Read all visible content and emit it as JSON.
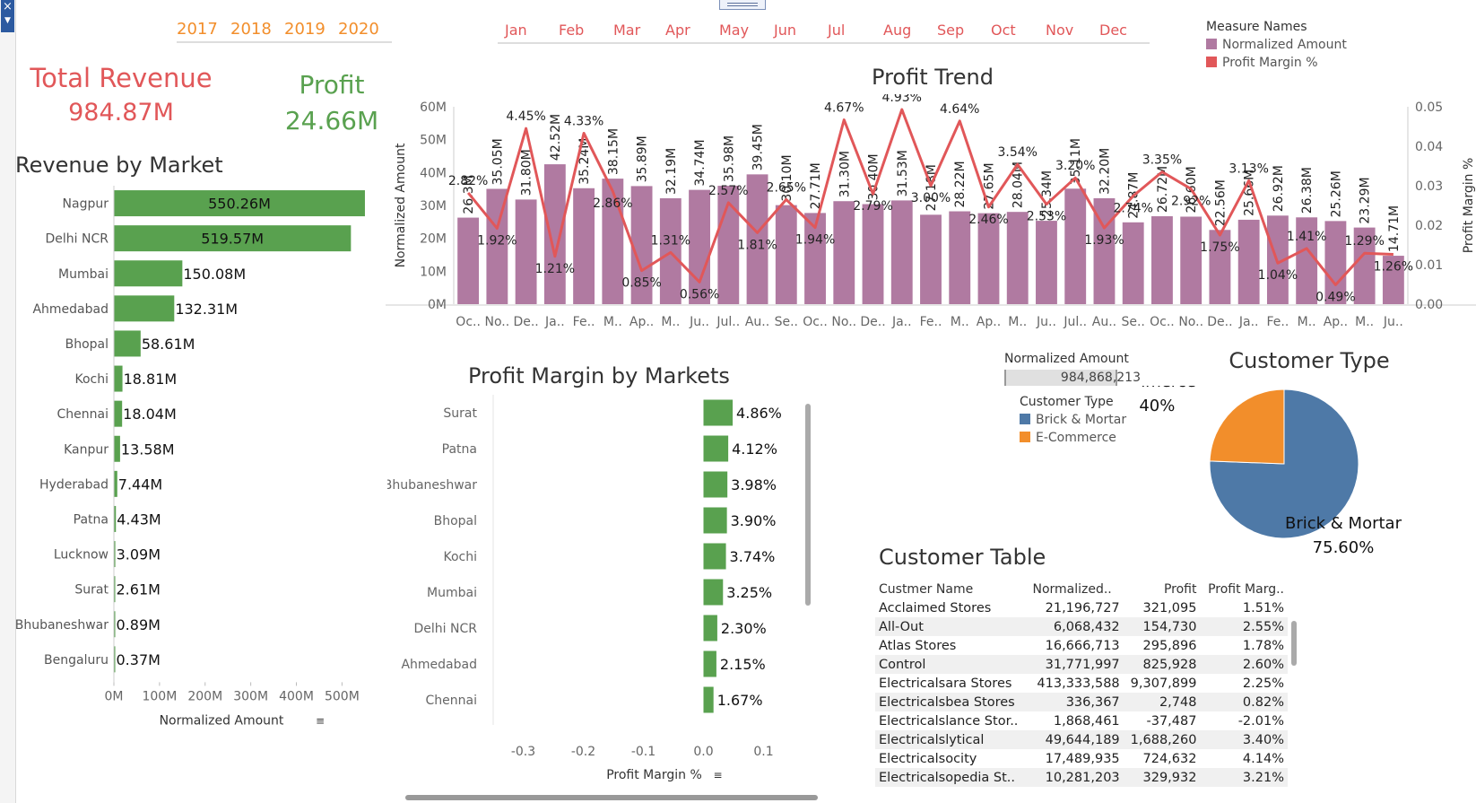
{
  "years": [
    "2017",
    "2018",
    "2019",
    "2020"
  ],
  "months": [
    "Jan",
    "Feb",
    "Mar",
    "Apr",
    "May",
    "Jun",
    "Jul",
    "Aug",
    "Sep",
    "Oct",
    "Nov",
    "Dec"
  ],
  "kpis": {
    "total_revenue_label": "Total Revenue",
    "total_revenue_value": "984.87M",
    "profit_label": "Profit",
    "profit_value": "24.66M"
  },
  "legend_measures": {
    "title": "Measure Names",
    "items": [
      {
        "label": "Normalized Amount",
        "color": "#b07aa1"
      },
      {
        "label": "Profit Margin %",
        "color": "#e15759"
      }
    ]
  },
  "customer_legend": {
    "title": "Customer Type",
    "items": [
      {
        "label": "Brick & Mortar",
        "color": "#4e79a7"
      },
      {
        "label": "E-Commerce",
        "color": "#f28e2b"
      }
    ]
  },
  "norm_filter": {
    "label": "Normalized Amount",
    "value": "984,868,213"
  },
  "colors": {
    "green": "#59a14f",
    "purple": "#b07aa1",
    "red": "#e15759",
    "blue": "#4e79a7",
    "orange": "#f28e2b"
  },
  "chart_data": [
    {
      "id": "revenue-by-market",
      "type": "bar",
      "orientation": "horizontal",
      "title": "Revenue by Market",
      "xlabel": "Normalized Amount",
      "xlim": [
        0,
        570
      ],
      "xticks": [
        "0M",
        "100M",
        "200M",
        "300M",
        "400M",
        "500M"
      ],
      "categories": [
        "Nagpur",
        "Delhi NCR",
        "Mumbai",
        "Ahmedabad",
        "Bhopal",
        "Kochi",
        "Chennai",
        "Kanpur",
        "Hyderabad",
        "Patna",
        "Lucknow",
        "Surat",
        "Bhubaneshwar",
        "Bengaluru"
      ],
      "values": [
        550.26,
        519.57,
        150.08,
        132.31,
        58.61,
        18.81,
        18.04,
        13.58,
        7.44,
        4.43,
        3.09,
        2.61,
        0.89,
        0.37
      ],
      "labels": [
        "550.26M",
        "519.57M",
        "150.08M",
        "132.31M",
        "58.61M",
        "18.81M",
        "18.04M",
        "13.58M",
        "7.44M",
        "4.43M",
        "3.09M",
        "2.61M",
        "0.89M",
        "0.37M"
      ]
    },
    {
      "id": "profit-trend",
      "type": "bar",
      "combo": "bar+line",
      "title": "Profit Trend",
      "ylabel": "Normalized Amount",
      "y2label": "Profit Margin %",
      "ylim": [
        0,
        60
      ],
      "y2lim": [
        0,
        0.05
      ],
      "yticks": [
        "0M",
        "10M",
        "20M",
        "30M",
        "40M",
        "50M",
        "60M"
      ],
      "y2ticks": [
        "0.00",
        "0.01",
        "0.02",
        "0.03",
        "0.04",
        "0.05"
      ],
      "categories": [
        "Oc..",
        "No..",
        "De..",
        "Ja..",
        "Fe..",
        "M..",
        "Ap..",
        "M..",
        "Ju..",
        "Jul..",
        "Au..",
        "Se..",
        "Oc..",
        "No..",
        "De..",
        "Ja..",
        "Fe..",
        "M..",
        "Ap..",
        "M..",
        "Ju..",
        "Jul..",
        "Au..",
        "Se..",
        "Oc..",
        "No..",
        "De..",
        "Ja..",
        "Fe..",
        "M..",
        "Ap..",
        "M..",
        "Ju.."
      ],
      "series": [
        {
          "name": "Normalized Amount",
          "values": [
            26.3,
            35.05,
            31.8,
            42.52,
            35.24,
            38.15,
            35.89,
            32.19,
            34.74,
            35.98,
            39.45,
            30.1,
            27.71,
            31.3,
            30.4,
            31.53,
            27.18,
            28.22,
            27.65,
            28.04,
            25.34,
            35.11,
            32.2,
            24.87,
            26.72,
            26.6,
            22.56,
            25.66,
            26.92,
            26.38,
            25.26,
            23.29,
            14.71
          ],
          "labels": [
            "26.3M",
            "35.05M",
            "31.80M",
            "42.52M",
            "35.24M",
            "38.15M",
            "35.89M",
            "32.19M",
            "34.74M",
            "35.98M",
            "39.45M",
            "30.10M",
            "27.71M",
            "31.30M",
            "30.40M",
            "31.53M",
            "27.18M",
            "28.22M",
            "27.65M",
            "28.04M",
            "25.34M",
            "35.11M",
            "32.20M",
            "24.87M",
            "26.72M",
            "26.60M",
            "22.56M",
            "25.66M",
            "26.92M",
            "26.38M",
            "25.26M",
            "23.29M",
            "14.71M"
          ]
        },
        {
          "name": "Profit Margin %",
          "values": [
            0.0282,
            0.0192,
            0.0445,
            0.0121,
            0.0433,
            0.0286,
            0.0085,
            0.0131,
            0.0056,
            0.0257,
            0.0181,
            0.0265,
            0.0194,
            0.0467,
            0.0279,
            0.0493,
            0.03,
            0.0464,
            0.0246,
            0.0354,
            0.0253,
            0.032,
            0.0193,
            0.0274,
            0.0335,
            0.0292,
            0.0175,
            0.0313,
            0.0104,
            0.0141,
            0.0049,
            0.0129,
            0.0126
          ],
          "labels": [
            "2.82%",
            "1.92%",
            "4.45%",
            "1.21%",
            "4.33%",
            "2.86%",
            "0.85%",
            "1.31%",
            "0.56%",
            "2.57%",
            "1.81%",
            "2.65%",
            "1.94%",
            "4.67%",
            "2.79%",
            "4.93%",
            "3.00%",
            "4.64%",
            "2.46%",
            "3.54%",
            "2.53%",
            "3.20%",
            "1.93%",
            "2.74%",
            "3.35%",
            "2.92%",
            "1.75%",
            "3.13%",
            "1.04%",
            "1.41%",
            "0.49%",
            "1.29%",
            "1.26%"
          ]
        }
      ]
    },
    {
      "id": "profit-margin-by-markets",
      "type": "bar",
      "orientation": "horizontal",
      "title": "Profit Margin by Markets",
      "xlabel": "Profit Margin %",
      "xlim": [
        -0.35,
        0.15
      ],
      "xticks": [
        "-0.3",
        "-0.2",
        "-0.1",
        "0.0",
        "0.1"
      ],
      "categories": [
        "Surat",
        "Patna",
        "Bhubaneshwar",
        "Bhopal",
        "Kochi",
        "Mumbai",
        "Delhi NCR",
        "Ahmedabad",
        "Chennai"
      ],
      "values": [
        0.0486,
        0.0412,
        0.0398,
        0.039,
        0.0374,
        0.0325,
        0.023,
        0.0215,
        0.0167
      ],
      "labels": [
        "4.86%",
        "4.12%",
        "3.98%",
        "3.90%",
        "3.74%",
        "3.25%",
        "2.30%",
        "2.15%",
        "1.67%"
      ]
    },
    {
      "id": "customer-type",
      "type": "pie",
      "title": "Customer Type",
      "categories": [
        "Brick & Mortar",
        "E-Commerce"
      ],
      "values": [
        75.6,
        24.4
      ],
      "labels": [
        "75.60%",
        "24.40%"
      ]
    },
    {
      "id": "customer-table",
      "type": "table",
      "title": "Customer Table",
      "columns": [
        "Custmer Name",
        "Normalized..",
        "Profit",
        "Profit Marg.."
      ],
      "rows": [
        [
          "Acclaimed Stores",
          "21,196,727",
          "321,095",
          "1.51%"
        ],
        [
          "All-Out",
          "6,068,432",
          "154,730",
          "2.55%"
        ],
        [
          "Atlas Stores",
          "16,666,713",
          "295,896",
          "1.78%"
        ],
        [
          "Control",
          "31,771,997",
          "825,928",
          "2.60%"
        ],
        [
          "Electricalsara Stores",
          "413,333,588",
          "9,307,899",
          "2.25%"
        ],
        [
          "Electricalsbea Stores",
          "336,367",
          "2,748",
          "0.82%"
        ],
        [
          "Electricalslance Stor..",
          "1,868,461",
          "-37,487",
          "-2.01%"
        ],
        [
          "Electricalslytical",
          "49,644,189",
          "1,688,260",
          "3.40%"
        ],
        [
          "Electricalsocity",
          "17,489,935",
          "724,632",
          "4.14%"
        ],
        [
          "Electricalsopedia St..",
          "10,281,203",
          "329,932",
          "3.21%"
        ]
      ]
    }
  ]
}
